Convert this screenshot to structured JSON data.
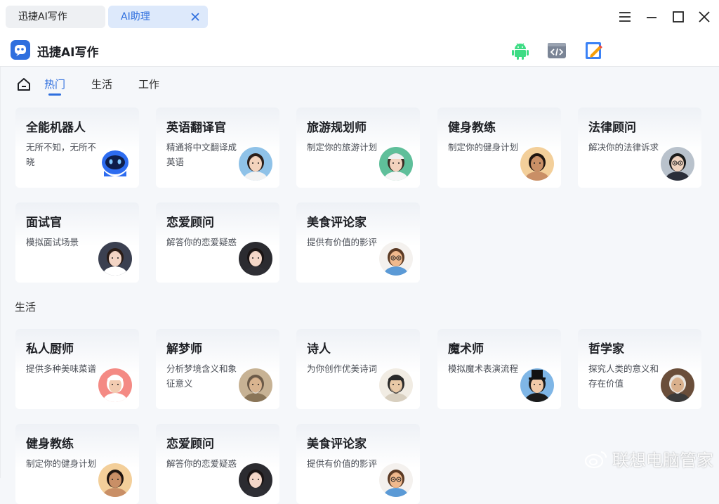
{
  "tabs": [
    {
      "label": "迅捷AI写作"
    },
    {
      "label": "AI助理"
    }
  ],
  "app": {
    "title": "迅捷AI写作"
  },
  "header_icons": [
    "android-icon",
    "code-window-icon",
    "edit-note-icon"
  ],
  "subnav": {
    "items": [
      {
        "label": "热门"
      },
      {
        "label": "生活"
      },
      {
        "label": "工作"
      }
    ],
    "active": "热门"
  },
  "sections": {
    "life_title": "生活"
  },
  "cards_hot": [
    {
      "title": "全能机器人",
      "desc": "无所不知，无所不晓",
      "avatar": "robot"
    },
    {
      "title": "英语翻译官",
      "desc": "精通将中文翻译成英语",
      "avatar": "girl-blue"
    },
    {
      "title": "旅游规划师",
      "desc": "制定你的旅游计划",
      "avatar": "girl-cap"
    },
    {
      "title": "健身教练",
      "desc": "制定你的健身计划",
      "avatar": "man-fit"
    },
    {
      "title": "法律顾问",
      "desc": "解决你的法律诉求",
      "avatar": "lawyer"
    },
    {
      "title": "面试官",
      "desc": "模拟面试场景",
      "avatar": "woman-interview"
    },
    {
      "title": "恋爱顾问",
      "desc": "解答你的恋爱疑惑",
      "avatar": "woman-love"
    },
    {
      "title": "美食评论家",
      "desc": "提供有价值的影评",
      "avatar": "cartoon-man"
    }
  ],
  "cards_life": [
    {
      "title": "私人厨师",
      "desc": "提供多种美味菜谱",
      "avatar": "chef"
    },
    {
      "title": "解梦师",
      "desc": "分析梦境含义和象征意义",
      "avatar": "old-sage"
    },
    {
      "title": "诗人",
      "desc": "为你创作优美诗词",
      "avatar": "ancient-poet"
    },
    {
      "title": "魔术师",
      "desc": "模拟魔术表演流程",
      "avatar": "magician"
    },
    {
      "title": "哲学家",
      "desc": "探究人类的意义和存在价值",
      "avatar": "philosopher"
    },
    {
      "title": "健身教练",
      "desc": "制定你的健身计划",
      "avatar": "man-fit"
    },
    {
      "title": "恋爱顾问",
      "desc": "解答你的恋爱疑惑",
      "avatar": "woman-love"
    },
    {
      "title": "美食评论家",
      "desc": "提供有价值的影评",
      "avatar": "cartoon-man"
    }
  ],
  "watermark": "联想电脑管家",
  "colors": {
    "accent": "#2f6fde",
    "bg": "#f5f7fa",
    "card": "#ffffff"
  }
}
